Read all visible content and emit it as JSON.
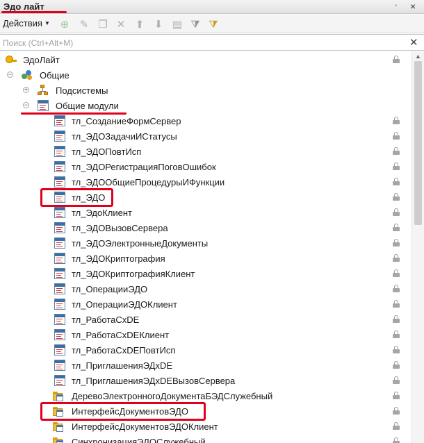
{
  "window": {
    "title": "Эдо лайт",
    "pin_icon": "pin-icon",
    "close_icon": "close-icon"
  },
  "toolbar": {
    "actions_label": "Действия",
    "buttons": [
      {
        "name": "add-icon",
        "glyph": "⊕"
      },
      {
        "name": "edit-icon",
        "glyph": "✎"
      },
      {
        "name": "copy-icon",
        "glyph": "❐"
      },
      {
        "name": "delete-icon",
        "glyph": "✕"
      },
      {
        "name": "move-up-icon",
        "glyph": "⬆"
      },
      {
        "name": "move-down-icon",
        "glyph": "⬇"
      },
      {
        "name": "sort-icon",
        "glyph": "▤"
      },
      {
        "name": "filter-icon",
        "glyph": "⧩"
      },
      {
        "name": "filter-clear-icon",
        "glyph": "⧩"
      }
    ]
  },
  "search": {
    "placeholder": "Поиск (Ctrl+Alt+M)",
    "value": ""
  },
  "tree": {
    "root": "ЭдоЛайт",
    "general": "Общие",
    "subsystems": "Подсистемы",
    "common_modules": "Общие модули",
    "modules": [
      "тл_СозданиеФормСервер",
      "тл_ЭДОЗадачиИСтатусы",
      "тл_ЭДОПовтИсп",
      "тл_ЭДОРегистрацияПоговОшибок",
      "тл_ЭДООбщиеПроцедурыИФункции",
      "тл_ЭДО",
      "тл_ЭдоКлиент",
      "тл_ЭДОВызовСервера",
      "тл_ЭДОЭлектронныеДокументы",
      "тл_ЭДОКриптография",
      "тл_ЭДОКриптографияКлиент",
      "тл_ОперацииЭДО",
      "тл_ОперацииЭДОКлиент",
      "тл_РаботаСхDE",
      "тл_РаботаСхDEКлиент",
      "тл_РаботаСхDEПовтИсп",
      "тл_ПриглашенияЭДхDE",
      "тл_ПриглашенияЭДхDEВызовСервера"
    ],
    "borrowed_modules": [
      "ДеревоЭлектронногоДокументаБЭДСлужебный",
      "ИнтерфейсДокументовЭДО",
      "ИнтерфейсДокументовЭДОКлиент",
      "СинхронизацияЭДОСлужебный"
    ]
  },
  "colors": {
    "highlight": "#e0001b",
    "module_header": "#3a6fa5",
    "folder": "#f1c232"
  }
}
